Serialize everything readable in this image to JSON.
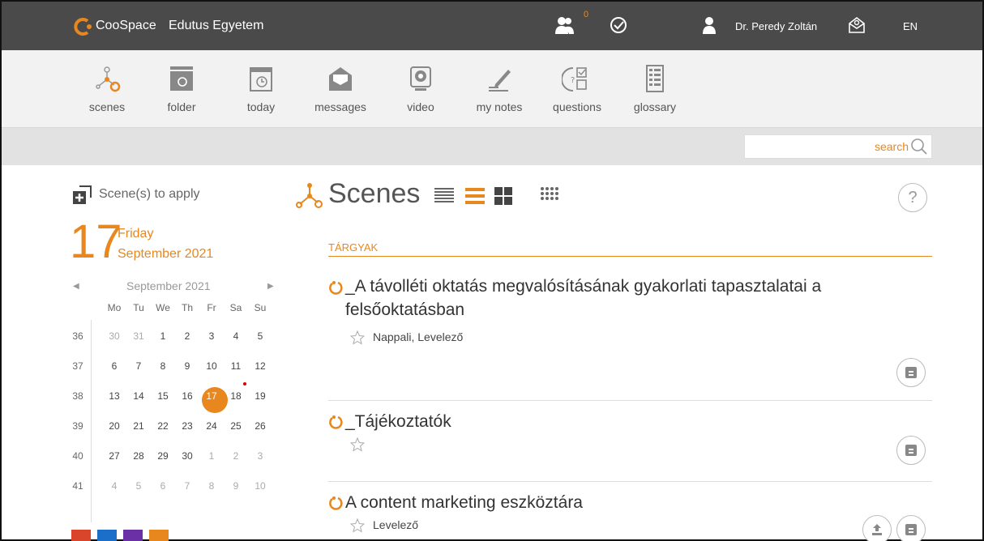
{
  "topbar": {
    "app_name": "CooSpace",
    "institution": "Edutus Egyetem",
    "notification_count": "0",
    "user_name": "Dr. Peredy Zoltán",
    "language": "EN"
  },
  "toolbar": {
    "items": [
      {
        "label": "scenes",
        "icon": "scenes-icon"
      },
      {
        "label": "folder",
        "icon": "folder-icon"
      },
      {
        "label": "today",
        "icon": "calendar-today-icon"
      },
      {
        "label": "messages",
        "icon": "envelope-icon"
      },
      {
        "label": "video",
        "icon": "webcam-icon"
      },
      {
        "label": "my notes",
        "icon": "pencil-icon"
      },
      {
        "label": "questions",
        "icon": "questions-icon"
      },
      {
        "label": "glossary",
        "icon": "glossary-icon"
      }
    ]
  },
  "search": {
    "placeholder": "search"
  },
  "sidebar": {
    "apply_label": "Scene(s) to apply",
    "date": {
      "day": "17",
      "weekday": "Friday",
      "month_year": "September 2021"
    },
    "calendar": {
      "title": "September 2021",
      "headers": [
        "Mo",
        "Tu",
        "We",
        "Th",
        "Fr",
        "Sa",
        "Su"
      ],
      "weeks": [
        {
          "num": "36",
          "days": [
            "30",
            "31",
            "1",
            "2",
            "3",
            "4",
            "5"
          ]
        },
        {
          "num": "37",
          "days": [
            "6",
            "7",
            "8",
            "9",
            "10",
            "11",
            "12"
          ]
        },
        {
          "num": "38",
          "days": [
            "13",
            "14",
            "15",
            "16",
            "17",
            "18",
            "19"
          ]
        },
        {
          "num": "39",
          "days": [
            "20",
            "21",
            "22",
            "23",
            "24",
            "25",
            "26"
          ]
        },
        {
          "num": "40",
          "days": [
            "27",
            "28",
            "29",
            "30",
            "1",
            "2",
            "3"
          ]
        },
        {
          "num": "41",
          "days": [
            "4",
            "5",
            "6",
            "7",
            "8",
            "9",
            "10"
          ]
        }
      ],
      "selected_day": "17"
    }
  },
  "main": {
    "title": "Scenes",
    "help": "?",
    "section_label": "TÁRGYAK",
    "items": [
      {
        "title": "_A távolléti oktatás megvalósításának gyakorlati tapasztalatai a felsőoktatásban",
        "tags": "Nappali, Levelező"
      },
      {
        "title": "_Tájékoztatók",
        "tags": ""
      },
      {
        "title": "A content marketing eszköztára",
        "tags": "Levelező"
      }
    ]
  },
  "colors": {
    "accent": "#e8871e",
    "topbar": "#4a4a4a"
  }
}
